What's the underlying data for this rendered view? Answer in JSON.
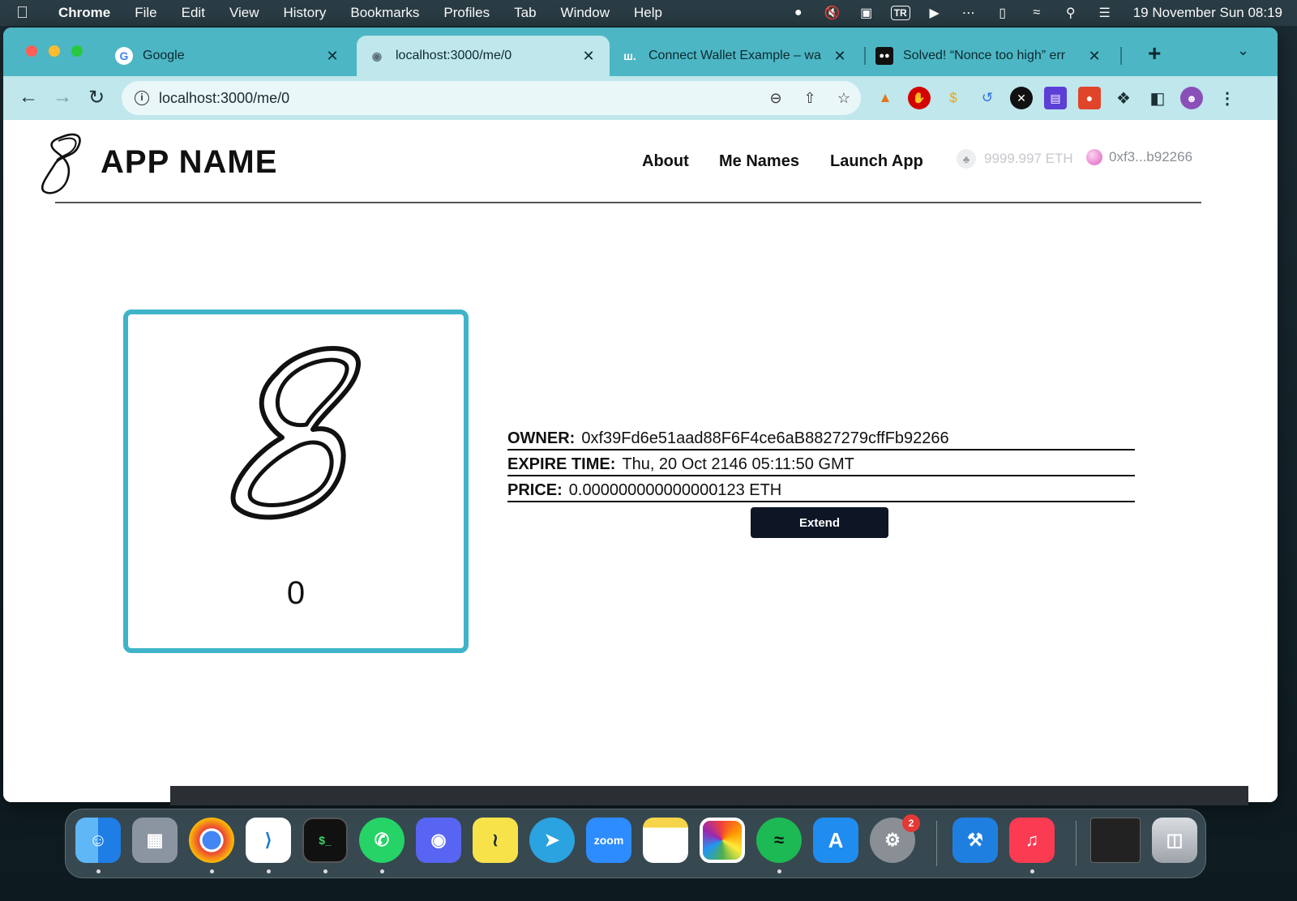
{
  "menubar": {
    "app": "Chrome",
    "items": [
      "File",
      "Edit",
      "View",
      "History",
      "Bookmarks",
      "Profiles",
      "Tab",
      "Window",
      "Help"
    ],
    "input_source": "TR",
    "clock": "19 November Sun  08:19"
  },
  "tabs": [
    {
      "title": "Google",
      "icon": "google-icon"
    },
    {
      "title": "localhost:3000/me/0",
      "icon": "globe-icon"
    },
    {
      "title": "Connect Wallet Example – wa",
      "icon": "wagmi-icon"
    },
    {
      "title": "Solved! “Nonce too high” err",
      "icon": "medium-icon"
    }
  ],
  "address_bar": {
    "url": "localhost:3000/me/0"
  },
  "site": {
    "app_name": "APP NAME",
    "nav": [
      "About",
      "Me Names",
      "Launch App"
    ],
    "balance": "9999.997 ETH",
    "account": "0xf3...b92266"
  },
  "card": {
    "number": "0"
  },
  "details": {
    "owner_label": "OWNER:",
    "owner_value": "0xf39Fd6e51aad88F6F4ce6aB8827279cffFb92266",
    "expire_label": "EXPIRE TIME:",
    "expire_value": "Thu, 20 Oct 2146 05:11:50 GMT",
    "price_label": "PRICE:",
    "price_value": "0.000000000000000123 ETH"
  },
  "extend_label": "Extend",
  "dock": {
    "apps": [
      "Finder",
      "Launchpad",
      "Chrome",
      "VS Code",
      "Terminal",
      "WhatsApp",
      "Discord",
      "Basecamp",
      "Telegram",
      "Zoom",
      "Notes",
      "Photos",
      "Spotify",
      "App Store",
      "System Settings",
      "Xcode",
      "Music",
      "Screen",
      "Trash"
    ],
    "zoom_label": "zoom",
    "settings_badge": "2"
  }
}
